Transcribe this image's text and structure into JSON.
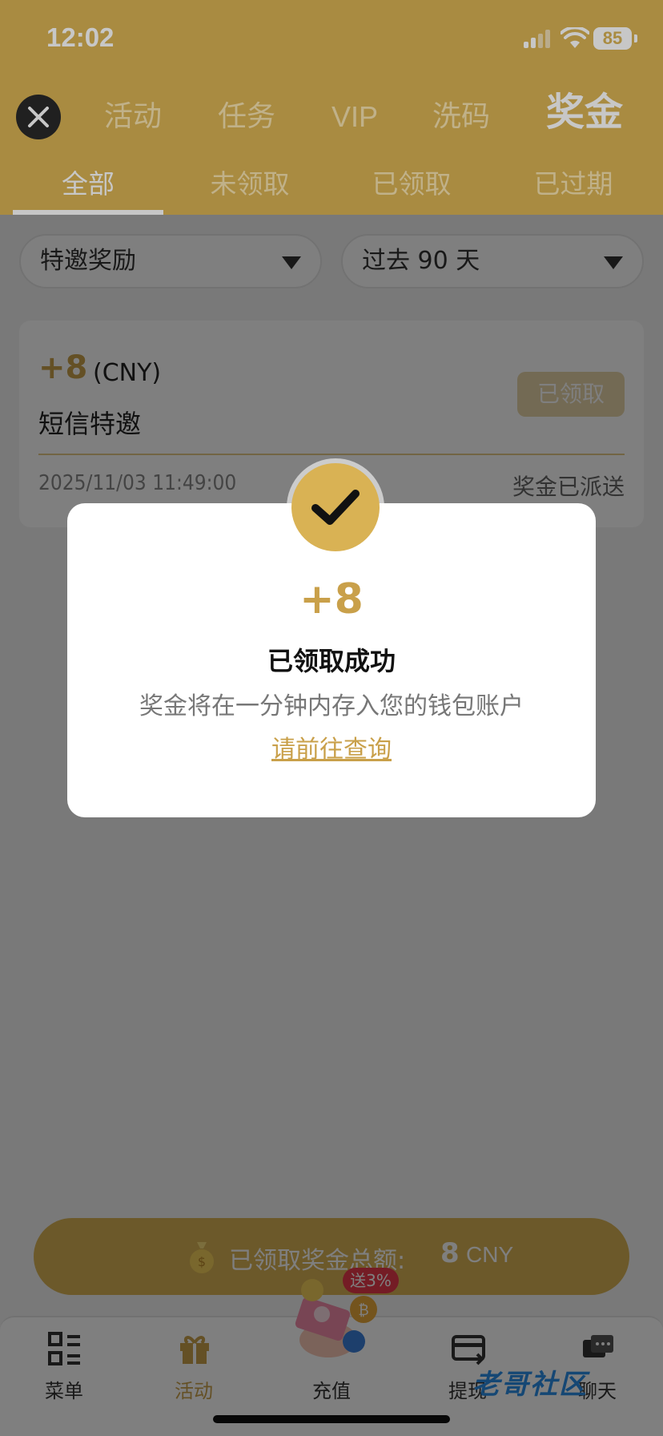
{
  "status_bar": {
    "time": "12:02",
    "battery": "85"
  },
  "header": {
    "top_tabs": [
      "活动",
      "任务",
      "VIP",
      "洗码",
      "奖金"
    ],
    "active_top_tab": "奖金",
    "sub_tabs": [
      "全部",
      "未领取",
      "已领取",
      "已过期"
    ],
    "active_sub_tab": "全部"
  },
  "filters": {
    "type": "特邀奖励",
    "range": "过去 90 天"
  },
  "card": {
    "amount": "+8",
    "currency": "(CNY)",
    "title": "短信特邀",
    "status_button": "已领取",
    "date": "2025/11/03 11:49:00",
    "note": "奖金已派送"
  },
  "total": {
    "label": "已领取奖金总额:",
    "value": "8",
    "currency": "CNY"
  },
  "bottom_nav": {
    "items": [
      {
        "label": "菜单",
        "icon": "menu-grid-icon"
      },
      {
        "label": "活动",
        "icon": "gift-icon"
      },
      {
        "label": "充值",
        "icon": "deposit-icon"
      },
      {
        "label": "提现",
        "icon": "withdraw-card-icon"
      },
      {
        "label": "聊天",
        "icon": "chat-icon"
      }
    ],
    "active": "活动",
    "promo_badge": "送3%"
  },
  "modal": {
    "amount": "+8",
    "title": "已领取成功",
    "description": "奖金将在一分钟内存入您的钱包账户",
    "link": "请前往查询"
  },
  "watermark": "老哥社区",
  "colors": {
    "accent": "#d9b254",
    "accent_text": "#c9a04a",
    "promo": "#e8384a"
  }
}
